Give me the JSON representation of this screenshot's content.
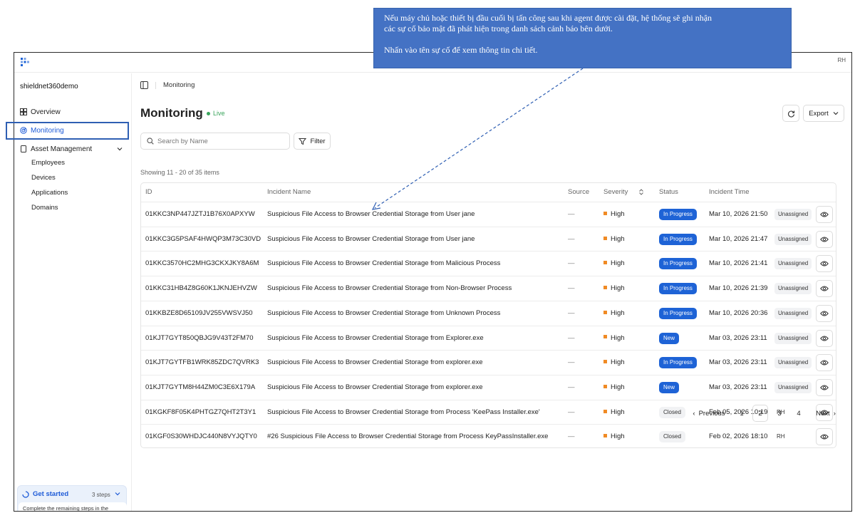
{
  "annotation": {
    "line1": "Nếu máy chủ hoặc thiết bị đầu cuối bị tấn công sau khi agent được cài đặt, hệ thống sẽ ghi nhận",
    "line2": "các sự cố bảo mật đã phát hiện trong danh sách cảnh báo bên dưới.",
    "line3": "Nhấn vào tên sự cố để xem thông tin chi tiết."
  },
  "topbar": {
    "avatar": "RH"
  },
  "sidebar": {
    "org": "shieldnet360demo",
    "overview": "Overview",
    "monitoring": "Monitoring",
    "asset_management": "Asset Management",
    "sub": [
      "Employees",
      "Devices",
      "Applications",
      "Domains"
    ],
    "get_started": {
      "title": "Get started",
      "steps": "3 steps",
      "body": "Complete the remaining steps in the checklist to get started"
    }
  },
  "breadcrumb": "Monitoring",
  "page": {
    "title": "Monitoring",
    "live": "Live",
    "export": "Export",
    "search_placeholder": "Search by Name",
    "filter": "Filter",
    "showing": "Showing 11 - 20 of 35 items"
  },
  "table": {
    "headers": {
      "id": "ID",
      "name": "Incident Name",
      "source": "Source",
      "severity": "Severity",
      "status": "Status",
      "time": "Incident Time"
    },
    "rows": [
      {
        "id": "01KKC3NP447JZTJ1B76X0APXYW",
        "name": "Suspicious File Access to Browser Credential Storage from User jane",
        "source": "—",
        "severity": "High",
        "status": "In Progress",
        "time": "Mar 10, 2026 21:50",
        "assignee": "Unassigned"
      },
      {
        "id": "01KKC3G5PSAF4HWQP3M73C30VD",
        "name": "Suspicious File Access to Browser Credential Storage from User jane",
        "source": "—",
        "severity": "High",
        "status": "In Progress",
        "time": "Mar 10, 2026 21:47",
        "assignee": "Unassigned"
      },
      {
        "id": "01KKC3570HC2MHG3CKXJKY8A6M",
        "name": "Suspicious File Access to Browser Credential Storage from Malicious Process",
        "source": "—",
        "severity": "High",
        "status": "In Progress",
        "time": "Mar 10, 2026 21:41",
        "assignee": "Unassigned"
      },
      {
        "id": "01KKC31HB4Z8G60K1JKNJEHVZW",
        "name": "Suspicious File Access to Browser Credential Storage from Non-Browser Process",
        "source": "—",
        "severity": "High",
        "status": "In Progress",
        "time": "Mar 10, 2026 21:39",
        "assignee": "Unassigned"
      },
      {
        "id": "01KKBZE8D65109JV255VWSVJ50",
        "name": "Suspicious File Access to Browser Credential Storage from Unknown Process",
        "source": "—",
        "severity": "High",
        "status": "In Progress",
        "time": "Mar 10, 2026 20:36",
        "assignee": "Unassigned"
      },
      {
        "id": "01KJT7GYT850QBJG9V43T2FM70",
        "name": "Suspicious File Access to Browser Credential Storage from Explorer.exe",
        "source": "—",
        "severity": "High",
        "status": "New",
        "time": "Mar 03, 2026 23:11",
        "assignee": "Unassigned"
      },
      {
        "id": "01KJT7GYTFB1WRK85ZDC7QVRK3",
        "name": "Suspicious File Access to Browser Credential Storage from explorer.exe",
        "source": "—",
        "severity": "High",
        "status": "In Progress",
        "time": "Mar 03, 2026 23:11",
        "assignee": "Unassigned"
      },
      {
        "id": "01KJT7GYTM8H44ZM0C3E6X179A",
        "name": "Suspicious File Access to Browser Credential Storage from explorer.exe",
        "source": "—",
        "severity": "High",
        "status": "New",
        "time": "Mar 03, 2026 23:11",
        "assignee": "Unassigned"
      },
      {
        "id": "01KGKF8F05K4PHTGZ7QHT2T3Y1",
        "name": "Suspicious File Access to Browser Credential Storage from Process 'KeePass Installer.exe'",
        "source": "—",
        "severity": "High",
        "status": "Closed",
        "time": "Feb 05, 2026 10:19",
        "assignee": "RH"
      },
      {
        "id": "01KGF0S30WHDJC440N8VYJQTY0",
        "name": "#26 Suspicious File Access to Browser Credential Storage from Process KeyPassInstaller.exe",
        "source": "—",
        "severity": "High",
        "status": "Closed",
        "time": "Feb 02, 2026 18:10",
        "assignee": "RH"
      }
    ]
  },
  "pagination": {
    "previous": "Previous",
    "pages": [
      "1",
      "2",
      "3",
      "4"
    ],
    "current": "2",
    "next": "Next"
  },
  "colors": {
    "accent": "#1e63d6",
    "live": "#3aa55d",
    "severity_high": "#f08a24",
    "annotation_bg": "#4472c4"
  }
}
